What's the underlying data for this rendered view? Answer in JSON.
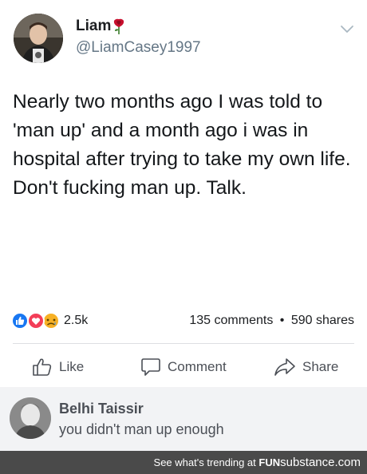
{
  "tweet": {
    "name": "Liam",
    "name_emoji": "rose-icon",
    "handle": "@LiamCasey1997",
    "text": "Nearly two months ago I was told to 'man up' and a month ago i was in hospital after trying to take my own life. Don't fucking man up. Talk."
  },
  "post": {
    "reactions": [
      "like-icon",
      "love-icon",
      "sad-icon"
    ],
    "reaction_count": "2.5k",
    "comments_label": "135 comments",
    "separator": "•",
    "shares_label": "590 shares"
  },
  "actions": {
    "like": "Like",
    "comment": "Comment",
    "share": "Share"
  },
  "comment": {
    "author": "Belhi Taissir",
    "text": "you didn't man up enough"
  },
  "footer": {
    "prefix": "See what's trending at",
    "brand_fun": "FUN",
    "brand_rest": "substance.com"
  },
  "colors": {
    "fb_blue": "#1877f2",
    "love_red": "#f33e58",
    "sad_yellow": "#f7b125",
    "footer_bg": "#4a4a4a"
  }
}
